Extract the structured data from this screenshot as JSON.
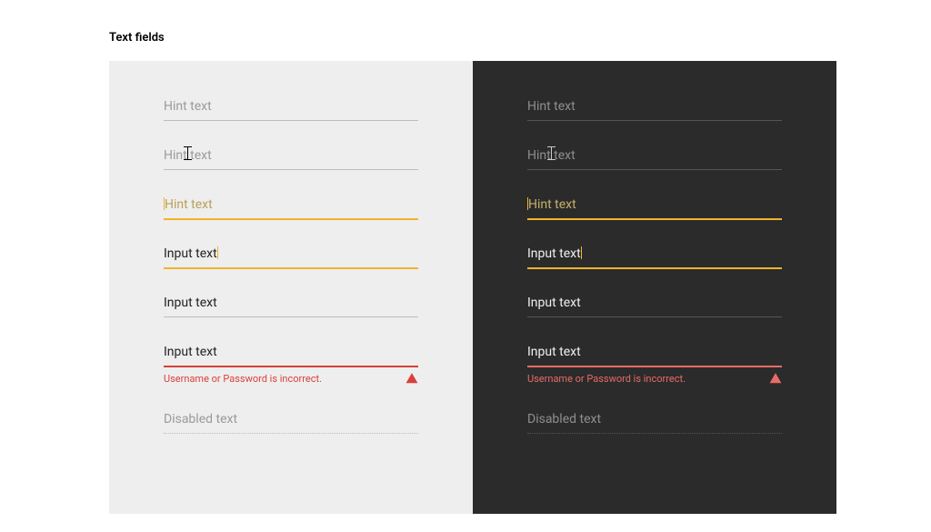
{
  "title": "Text fields",
  "colors": {
    "accent": "#f0b429",
    "error_light": "#d9403a",
    "error_dark": "#e86b67"
  },
  "fields": {
    "hint": "Hint text",
    "input": "Input text",
    "disabled": "Disabled text",
    "error_message": "Username or Password is incorrect."
  }
}
